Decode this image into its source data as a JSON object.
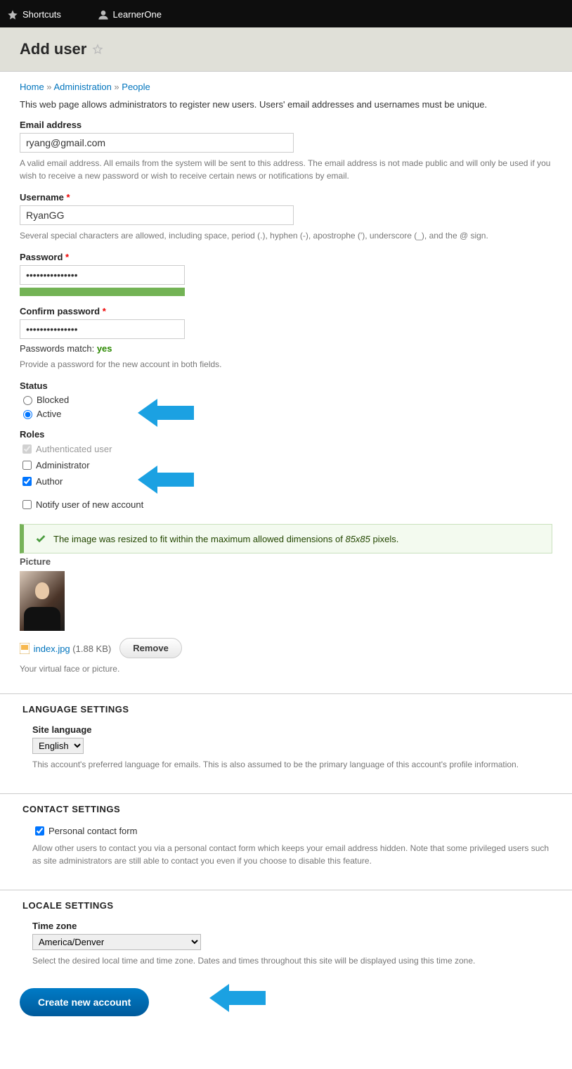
{
  "toolbar": {
    "shortcuts": "Shortcuts",
    "userlabel": "LearnerOne"
  },
  "page_title": "Add user",
  "breadcrumb": {
    "home": "Home",
    "admin": "Administration",
    "people": "People",
    "sep": " » "
  },
  "intro": "This web page allows administrators to register new users. Users' email addresses and usernames must be unique.",
  "email": {
    "label": "Email address",
    "value": "ryang@gmail.com",
    "help": "A valid email address. All emails from the system will be sent to this address. The email address is not made public and will only be used if you wish to receive a new password or wish to receive certain news or notifications by email."
  },
  "username": {
    "label": "Username",
    "value": "RyanGG",
    "help": "Several special characters are allowed, including space, period (.), hyphen (-), apostrophe ('), underscore (_), and the @ sign."
  },
  "password": {
    "label": "Password",
    "value": "•••••••••••••••"
  },
  "confirm": {
    "label": "Confirm password",
    "value": "•••••••••••••••",
    "match_label": "Passwords match: ",
    "match_value": "yes",
    "help": "Provide a password for the new account in both fields."
  },
  "status": {
    "legend": "Status",
    "blocked": "Blocked",
    "active": "Active"
  },
  "roles": {
    "legend": "Roles",
    "authenticated": "Authenticated user",
    "admin": "Administrator",
    "author": "Author"
  },
  "notify": "Notify user of new account",
  "resize_msg": {
    "pre": "The image was resized to fit within the maximum allowed dimensions of ",
    "dim": "85x85",
    "post": " pixels."
  },
  "picture": {
    "label": "Picture",
    "filename": "index.jpg",
    "filesize": "(1.88 KB)",
    "remove": "Remove",
    "help": "Your virtual face or picture."
  },
  "lang": {
    "legend": "LANGUAGE SETTINGS",
    "label": "Site language",
    "selected": "English",
    "help": "This account's preferred language for emails. This is also assumed to be the primary language of this account's profile information."
  },
  "contact": {
    "legend": "CONTACT SETTINGS",
    "checkbox": "Personal contact form",
    "help": "Allow other users to contact you via a personal contact form which keeps your email address hidden. Note that some privileged users such as site administrators are still able to contact you even if you choose to disable this feature."
  },
  "locale": {
    "legend": "LOCALE SETTINGS",
    "label": "Time zone",
    "selected": "America/Denver",
    "help": "Select the desired local time and time zone. Dates and times throughout this site will be displayed using this time zone."
  },
  "submit": "Create new account"
}
